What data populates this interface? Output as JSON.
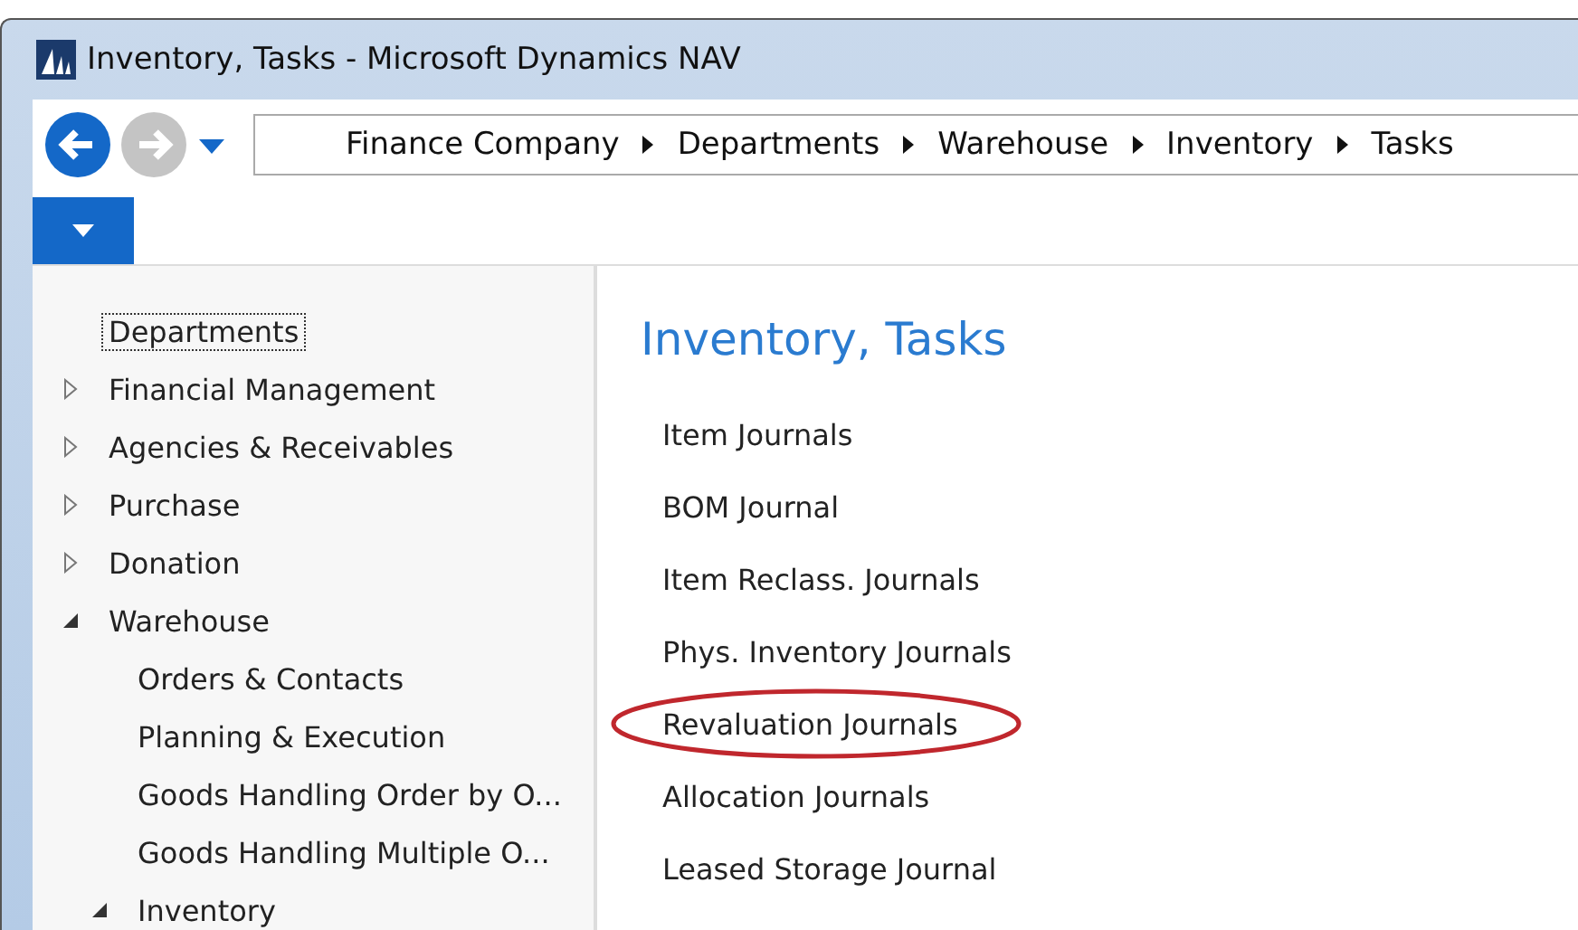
{
  "window": {
    "title": "Inventory, Tasks - Microsoft Dynamics NAV"
  },
  "breadcrumb": [
    "Finance Company",
    "Departments",
    "Warehouse",
    "Inventory",
    "Tasks"
  ],
  "tree": [
    {
      "label": "Departments",
      "selected": true
    },
    {
      "label": "Financial Management",
      "expanded": false,
      "selected": false
    },
    {
      "label": "Agencies & Receivables",
      "expanded": false,
      "selected": false
    },
    {
      "label": "Purchase",
      "expanded": false,
      "selected": false
    },
    {
      "label": "Donation",
      "expanded": false,
      "selected": false
    },
    {
      "label": "Warehouse",
      "expanded": true,
      "selected": false,
      "children": [
        {
          "label": "Orders & Contacts",
          "selected": false
        },
        {
          "label": "Planning & Execution",
          "selected": false
        },
        {
          "label": "Goods Handling Order by O...",
          "selected": false
        },
        {
          "label": "Goods Handling Multiple O...",
          "selected": false
        },
        {
          "label": "Inventory",
          "expanded": true,
          "selected": false
        }
      ]
    }
  ],
  "content": {
    "title": "Inventory, Tasks",
    "links": [
      {
        "label": "Item Journals",
        "circled": false
      },
      {
        "label": "BOM Journal",
        "circled": false
      },
      {
        "label": "Item Reclass. Journals",
        "circled": false
      },
      {
        "label": "Phys. Inventory Journals",
        "circled": false
      },
      {
        "label": "Revaluation Journals",
        "circled": true
      },
      {
        "label": "Allocation Journals",
        "circled": false
      },
      {
        "label": "Leased Storage Journal",
        "circled": false
      }
    ]
  }
}
